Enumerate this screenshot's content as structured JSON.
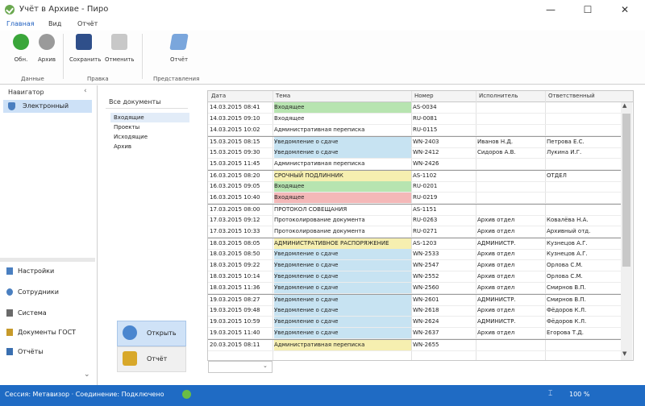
{
  "window": {
    "title": "Учёт в Архиве - Пиро",
    "min": "—",
    "max": "☐",
    "close": "✕"
  },
  "ribbon": {
    "tabs": [
      "Главная",
      "Вид",
      "Отчёт"
    ],
    "buttons": [
      {
        "label": "Обн.",
        "icon": "refresh-icon",
        "color": "#3aa63a"
      },
      {
        "label": "Архив",
        "icon": "gear-icon",
        "color": "#8a8a8a"
      },
      {
        "label": "Сохранить",
        "icon": "save-icon",
        "color": "#2f4f8a"
      },
      {
        "label": "Отменить",
        "icon": "undo-icon",
        "color": "#b0b0b0"
      },
      {
        "label": "Отчёт",
        "icon": "report-icon",
        "color": "#5a8fd0"
      }
    ],
    "groups": [
      "Данные",
      "Правка",
      "Представления"
    ]
  },
  "nav": {
    "title": "Навигатор",
    "pin": "‹",
    "active_item": "Электронный",
    "links": [
      "Настройки",
      "Сотрудники",
      "Система",
      "Документы ГОСТ",
      "Отчёты"
    ],
    "chevron": "⌄"
  },
  "folders": {
    "header": "Все документы",
    "items": [
      "Входящие",
      "Проекты",
      "Исходящие",
      "Архив"
    ],
    "button_1": "Открыть",
    "button_2": "Отчёт"
  },
  "grid": {
    "headers": [
      "Дата",
      "Тема",
      "Номер",
      "Исполнитель",
      "Ответственный"
    ],
    "rows": [
      {
        "c": [
          "14.03.2015 08:41",
          "Входящее",
          "AS-0034",
          "",
          ""
        ],
        "bg": "#b7e4b0",
        "sep": false
      },
      {
        "c": [
          "14.03.2015 09:10",
          "Входящее",
          "RU-0081",
          "",
          ""
        ],
        "bg": "",
        "sep": false
      },
      {
        "c": [
          "14.03.2015 10:02",
          "Административная переписка",
          "RU-0115",
          "",
          ""
        ],
        "bg": "",
        "sep": false
      },
      {
        "c": [
          "15.03.2015 08:15",
          "Уведомление о сдаче",
          "WN-2403",
          "Иванов Н.Д.",
          "Петрова Е.С."
        ],
        "bg": "#c7e3f2",
        "sep": true
      },
      {
        "c": [
          "15.03.2015 09:30",
          "Уведомление о сдаче",
          "WN-2412",
          "Сидоров А.В.",
          "Лукина И.Г."
        ],
        "bg": "#c7e3f2",
        "sep": false
      },
      {
        "c": [
          "15.03.2015 11:45",
          "Административная переписка",
          "WN-2426",
          "",
          ""
        ],
        "bg": "",
        "sep": false
      },
      {
        "c": [
          "16.03.2015 08:20",
          "СРОЧНЫЙ ПОДЛИННИК",
          "AS-1102",
          "",
          "ОТДЕЛ"
        ],
        "bg": "#f6efb0",
        "sep": true
      },
      {
        "c": [
          "16.03.2015 09:05",
          "Входящее",
          "RU-0201",
          "",
          ""
        ],
        "bg": "#b7e4b0",
        "sep": false
      },
      {
        "c": [
          "16.03.2015 10:40",
          "Входящее",
          "RU-0219",
          "",
          ""
        ],
        "bg": "#f4b8b8",
        "sep": false
      },
      {
        "c": [
          "17.03.2015 08:00",
          "ПРОТОКОЛ СОВЕЩАНИЯ",
          "AS-1151",
          "",
          ""
        ],
        "bg": "",
        "sep": true
      },
      {
        "c": [
          "17.03.2015 09:12",
          "Протоколирование документа",
          "RU-0263",
          "Архив отдел",
          "Ковалёва Н.А."
        ],
        "bg": "",
        "sep": false
      },
      {
        "c": [
          "17.03.2015 10:33",
          "Протоколирование документа",
          "RU-0271",
          "Архив отдел",
          "Архивный отд."
        ],
        "bg": "",
        "sep": false
      },
      {
        "c": [
          "18.03.2015 08:05",
          "АДМИНИСТРАТИВНОЕ РАСПОРЯЖЕНИЕ",
          "AS-1203",
          "АДМИНИСТР.",
          "Кузнецов А.Г."
        ],
        "bg": "#f6efb0",
        "sep": true
      },
      {
        "c": [
          "18.03.2015 08:50",
          "Уведомление о сдаче",
          "WN-2533",
          "Архив отдел",
          "Кузнецов А.Г."
        ],
        "bg": "#c7e3f2",
        "sep": false
      },
      {
        "c": [
          "18.03.2015 09:22",
          "Уведомление о сдаче",
          "WN-2547",
          "Архив отдел",
          "Орлова С.М."
        ],
        "bg": "#c7e3f2",
        "sep": false
      },
      {
        "c": [
          "18.03.2015 10:14",
          "Уведомление о сдаче",
          "WN-2552",
          "Архив отдел",
          "Орлова С.М."
        ],
        "bg": "#c7e3f2",
        "sep": false
      },
      {
        "c": [
          "18.03.2015 11:36",
          "Уведомление о сдаче",
          "WN-2560",
          "Архив отдел",
          "Смирнов В.П."
        ],
        "bg": "#c7e3f2",
        "sep": false
      },
      {
        "c": [
          "19.03.2015 08:27",
          "Уведомление о сдаче",
          "WN-2601",
          "АДМИНИСТР.",
          "Смирнов В.П."
        ],
        "bg": "#c7e3f2",
        "sep": true
      },
      {
        "c": [
          "19.03.2015 09:48",
          "Уведомление о сдаче",
          "WN-2618",
          "Архив отдел",
          "Фёдоров К.Л."
        ],
        "bg": "#c7e3f2",
        "sep": false
      },
      {
        "c": [
          "19.03.2015 10:59",
          "Уведомление о сдаче",
          "WN-2624",
          "АДМИНИСТР.",
          "Фёдоров К.Л."
        ],
        "bg": "#c7e3f2",
        "sep": false
      },
      {
        "c": [
          "19.03.2015 11:40",
          "Уведомление о сдаче",
          "WN-2637",
          "Архив отдел",
          "Егорова Т.Д."
        ],
        "bg": "#c7e3f2",
        "sep": false
      },
      {
        "c": [
          "20.03.2015 08:11",
          "Административная переписка",
          "WN-2655",
          "",
          ""
        ],
        "bg": "#f6efb0",
        "sep": true
      }
    ],
    "filter_value": "",
    "scroll_up": "▲",
    "scroll_down": "▼"
  },
  "status": {
    "text": "Сессия: Метавизор · Соединение: Подключено",
    "mid": "⌶",
    "right": "100 %"
  }
}
